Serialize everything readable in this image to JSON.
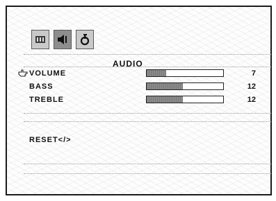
{
  "menu": {
    "title": "AUDIO",
    "tabs": [
      {
        "icon": "picture-icon",
        "active": false
      },
      {
        "icon": "speaker-icon",
        "active": true
      },
      {
        "icon": "setup-icon",
        "active": false
      }
    ],
    "items": [
      {
        "label": "VOLUME",
        "value": "7",
        "level": 0.25,
        "selected": true
      },
      {
        "label": "BASS",
        "value": "12",
        "level": 0.47,
        "selected": false
      },
      {
        "label": "TREBLE",
        "value": "12",
        "level": 0.47,
        "selected": false
      }
    ],
    "reset_label": "RESET</>"
  }
}
